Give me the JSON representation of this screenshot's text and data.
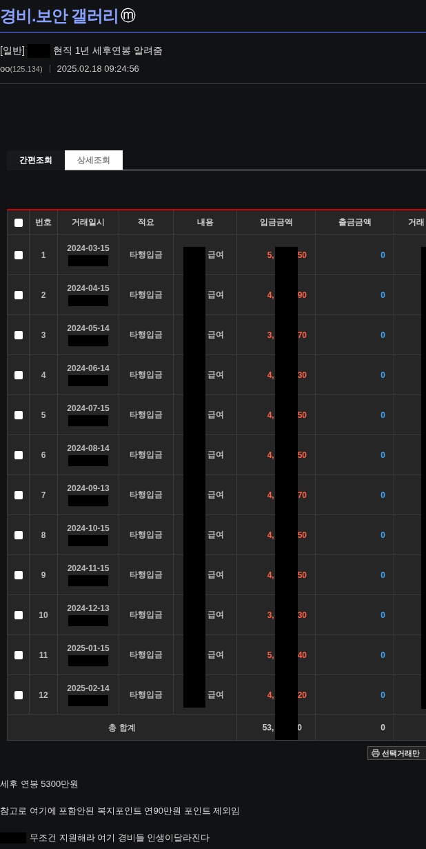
{
  "gallery": {
    "title": "경비.보안 갤러리",
    "badge": "ⓜ"
  },
  "post": {
    "category": "[일반]",
    "title": "현직 1년 세후연봉 알려줌",
    "author": "oo",
    "ip": "(125.134)",
    "date": "2025.02.18 09:24:56"
  },
  "tabs": [
    {
      "label": "간편조회",
      "selected": true
    },
    {
      "label": "상세조회",
      "selected": false
    }
  ],
  "table": {
    "columns": [
      "번호",
      "거래일시",
      "적요",
      "내용",
      "입금금액",
      "출금금액",
      "거래"
    ],
    "rows": [
      {
        "checked": false,
        "no": "1",
        "date": "2024-03-15",
        "type": "타행입금",
        "content": "급여",
        "deposit_head": "5,",
        "deposit_tail": "50",
        "withdrawal": "0"
      },
      {
        "checked": false,
        "no": "2",
        "date": "2024-04-15",
        "type": "타행입금",
        "content": "급여",
        "deposit_head": "4,",
        "deposit_tail": "90",
        "withdrawal": "0"
      },
      {
        "checked": false,
        "no": "3",
        "date": "2024-05-14",
        "type": "타행입금",
        "content": "급여",
        "deposit_head": "3,",
        "deposit_tail": "70",
        "withdrawal": "0"
      },
      {
        "checked": false,
        "no": "4",
        "date": "2024-06-14",
        "type": "타행입금",
        "content": "급여",
        "deposit_head": "4,",
        "deposit_tail": "30",
        "withdrawal": "0"
      },
      {
        "checked": false,
        "no": "5",
        "date": "2024-07-15",
        "type": "타행입금",
        "content": "급여",
        "deposit_head": "4,",
        "deposit_tail": "50",
        "withdrawal": "0"
      },
      {
        "checked": false,
        "no": "6",
        "date": "2024-08-14",
        "type": "타행입금",
        "content": "급여",
        "deposit_head": "4,",
        "deposit_tail": "50",
        "withdrawal": "0"
      },
      {
        "checked": false,
        "no": "7",
        "date": "2024-09-13",
        "type": "타행입금",
        "content": "급여",
        "deposit_head": "4,",
        "deposit_tail": "70",
        "withdrawal": "0"
      },
      {
        "checked": false,
        "no": "8",
        "date": "2024-10-15",
        "type": "타행입금",
        "content": "급여",
        "deposit_head": "4,",
        "deposit_tail": "50",
        "withdrawal": "0"
      },
      {
        "checked": false,
        "no": "9",
        "date": "2024-11-15",
        "type": "타행입금",
        "content": "급여",
        "deposit_head": "4,",
        "deposit_tail": "50",
        "withdrawal": "0"
      },
      {
        "checked": false,
        "no": "10",
        "date": "2024-12-13",
        "type": "타행입금",
        "content": "급여",
        "deposit_head": "3,",
        "deposit_tail": "30",
        "withdrawal": "0"
      },
      {
        "checked": false,
        "no": "11",
        "date": "2025-01-15",
        "type": "타행입금",
        "content": "급여",
        "deposit_head": "5,",
        "deposit_tail": "40",
        "withdrawal": "0"
      },
      {
        "checked": false,
        "no": "12",
        "date": "2025-02-14",
        "type": "타행입금",
        "content": "급여",
        "deposit_head": "4,",
        "deposit_tail": "20",
        "withdrawal": "0"
      }
    ],
    "total": {
      "label": "총 합계",
      "deposit_head": "53,",
      "deposit_tail": "0",
      "withdrawal": "0"
    },
    "select_all": {
      "checked": false
    }
  },
  "print_button": "선택거래만",
  "body": [
    "세후 연봉 5300만원",
    "참고로 여기에 포함안된 복지포인트 연90만원 포인트 제외임",
    "무조건 지원해라 여기 경비들 인생이달라진다"
  ]
}
